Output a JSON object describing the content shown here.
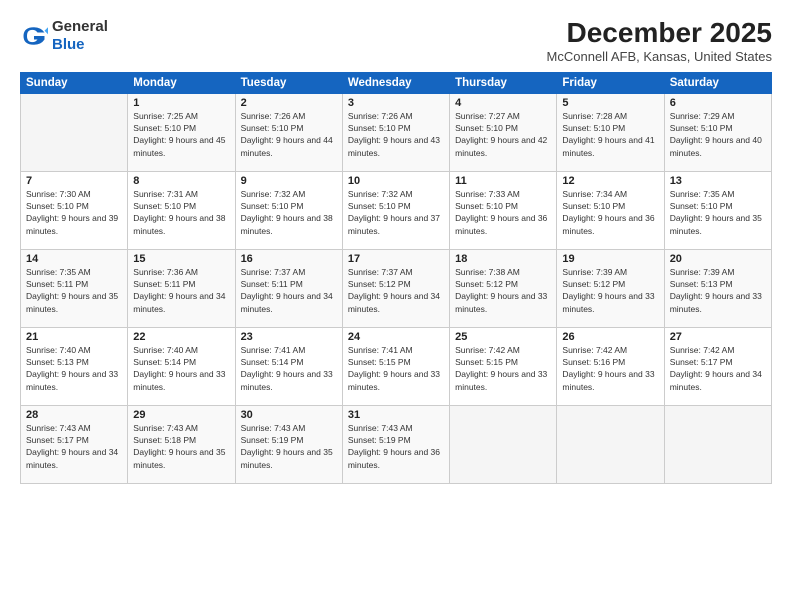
{
  "logo": {
    "general": "General",
    "blue": "Blue"
  },
  "header": {
    "month": "December 2025",
    "location": "McConnell AFB, Kansas, United States"
  },
  "weekdays": [
    "Sunday",
    "Monday",
    "Tuesday",
    "Wednesday",
    "Thursday",
    "Friday",
    "Saturday"
  ],
  "weeks": [
    [
      {
        "day": "",
        "sunrise": "",
        "sunset": "",
        "daylight": ""
      },
      {
        "day": "1",
        "sunrise": "Sunrise: 7:25 AM",
        "sunset": "Sunset: 5:10 PM",
        "daylight": "Daylight: 9 hours and 45 minutes."
      },
      {
        "day": "2",
        "sunrise": "Sunrise: 7:26 AM",
        "sunset": "Sunset: 5:10 PM",
        "daylight": "Daylight: 9 hours and 44 minutes."
      },
      {
        "day": "3",
        "sunrise": "Sunrise: 7:26 AM",
        "sunset": "Sunset: 5:10 PM",
        "daylight": "Daylight: 9 hours and 43 minutes."
      },
      {
        "day": "4",
        "sunrise": "Sunrise: 7:27 AM",
        "sunset": "Sunset: 5:10 PM",
        "daylight": "Daylight: 9 hours and 42 minutes."
      },
      {
        "day": "5",
        "sunrise": "Sunrise: 7:28 AM",
        "sunset": "Sunset: 5:10 PM",
        "daylight": "Daylight: 9 hours and 41 minutes."
      },
      {
        "day": "6",
        "sunrise": "Sunrise: 7:29 AM",
        "sunset": "Sunset: 5:10 PM",
        "daylight": "Daylight: 9 hours and 40 minutes."
      }
    ],
    [
      {
        "day": "7",
        "sunrise": "Sunrise: 7:30 AM",
        "sunset": "Sunset: 5:10 PM",
        "daylight": "Daylight: 9 hours and 39 minutes."
      },
      {
        "day": "8",
        "sunrise": "Sunrise: 7:31 AM",
        "sunset": "Sunset: 5:10 PM",
        "daylight": "Daylight: 9 hours and 38 minutes."
      },
      {
        "day": "9",
        "sunrise": "Sunrise: 7:32 AM",
        "sunset": "Sunset: 5:10 PM",
        "daylight": "Daylight: 9 hours and 38 minutes."
      },
      {
        "day": "10",
        "sunrise": "Sunrise: 7:32 AM",
        "sunset": "Sunset: 5:10 PM",
        "daylight": "Daylight: 9 hours and 37 minutes."
      },
      {
        "day": "11",
        "sunrise": "Sunrise: 7:33 AM",
        "sunset": "Sunset: 5:10 PM",
        "daylight": "Daylight: 9 hours and 36 minutes."
      },
      {
        "day": "12",
        "sunrise": "Sunrise: 7:34 AM",
        "sunset": "Sunset: 5:10 PM",
        "daylight": "Daylight: 9 hours and 36 minutes."
      },
      {
        "day": "13",
        "sunrise": "Sunrise: 7:35 AM",
        "sunset": "Sunset: 5:10 PM",
        "daylight": "Daylight: 9 hours and 35 minutes."
      }
    ],
    [
      {
        "day": "14",
        "sunrise": "Sunrise: 7:35 AM",
        "sunset": "Sunset: 5:11 PM",
        "daylight": "Daylight: 9 hours and 35 minutes."
      },
      {
        "day": "15",
        "sunrise": "Sunrise: 7:36 AM",
        "sunset": "Sunset: 5:11 PM",
        "daylight": "Daylight: 9 hours and 34 minutes."
      },
      {
        "day": "16",
        "sunrise": "Sunrise: 7:37 AM",
        "sunset": "Sunset: 5:11 PM",
        "daylight": "Daylight: 9 hours and 34 minutes."
      },
      {
        "day": "17",
        "sunrise": "Sunrise: 7:37 AM",
        "sunset": "Sunset: 5:12 PM",
        "daylight": "Daylight: 9 hours and 34 minutes."
      },
      {
        "day": "18",
        "sunrise": "Sunrise: 7:38 AM",
        "sunset": "Sunset: 5:12 PM",
        "daylight": "Daylight: 9 hours and 33 minutes."
      },
      {
        "day": "19",
        "sunrise": "Sunrise: 7:39 AM",
        "sunset": "Sunset: 5:12 PM",
        "daylight": "Daylight: 9 hours and 33 minutes."
      },
      {
        "day": "20",
        "sunrise": "Sunrise: 7:39 AM",
        "sunset": "Sunset: 5:13 PM",
        "daylight": "Daylight: 9 hours and 33 minutes."
      }
    ],
    [
      {
        "day": "21",
        "sunrise": "Sunrise: 7:40 AM",
        "sunset": "Sunset: 5:13 PM",
        "daylight": "Daylight: 9 hours and 33 minutes."
      },
      {
        "day": "22",
        "sunrise": "Sunrise: 7:40 AM",
        "sunset": "Sunset: 5:14 PM",
        "daylight": "Daylight: 9 hours and 33 minutes."
      },
      {
        "day": "23",
        "sunrise": "Sunrise: 7:41 AM",
        "sunset": "Sunset: 5:14 PM",
        "daylight": "Daylight: 9 hours and 33 minutes."
      },
      {
        "day": "24",
        "sunrise": "Sunrise: 7:41 AM",
        "sunset": "Sunset: 5:15 PM",
        "daylight": "Daylight: 9 hours and 33 minutes."
      },
      {
        "day": "25",
        "sunrise": "Sunrise: 7:42 AM",
        "sunset": "Sunset: 5:15 PM",
        "daylight": "Daylight: 9 hours and 33 minutes."
      },
      {
        "day": "26",
        "sunrise": "Sunrise: 7:42 AM",
        "sunset": "Sunset: 5:16 PM",
        "daylight": "Daylight: 9 hours and 33 minutes."
      },
      {
        "day": "27",
        "sunrise": "Sunrise: 7:42 AM",
        "sunset": "Sunset: 5:17 PM",
        "daylight": "Daylight: 9 hours and 34 minutes."
      }
    ],
    [
      {
        "day": "28",
        "sunrise": "Sunrise: 7:43 AM",
        "sunset": "Sunset: 5:17 PM",
        "daylight": "Daylight: 9 hours and 34 minutes."
      },
      {
        "day": "29",
        "sunrise": "Sunrise: 7:43 AM",
        "sunset": "Sunset: 5:18 PM",
        "daylight": "Daylight: 9 hours and 35 minutes."
      },
      {
        "day": "30",
        "sunrise": "Sunrise: 7:43 AM",
        "sunset": "Sunset: 5:19 PM",
        "daylight": "Daylight: 9 hours and 35 minutes."
      },
      {
        "day": "31",
        "sunrise": "Sunrise: 7:43 AM",
        "sunset": "Sunset: 5:19 PM",
        "daylight": "Daylight: 9 hours and 36 minutes."
      },
      {
        "day": "",
        "sunrise": "",
        "sunset": "",
        "daylight": ""
      },
      {
        "day": "",
        "sunrise": "",
        "sunset": "",
        "daylight": ""
      },
      {
        "day": "",
        "sunrise": "",
        "sunset": "",
        "daylight": ""
      }
    ]
  ]
}
